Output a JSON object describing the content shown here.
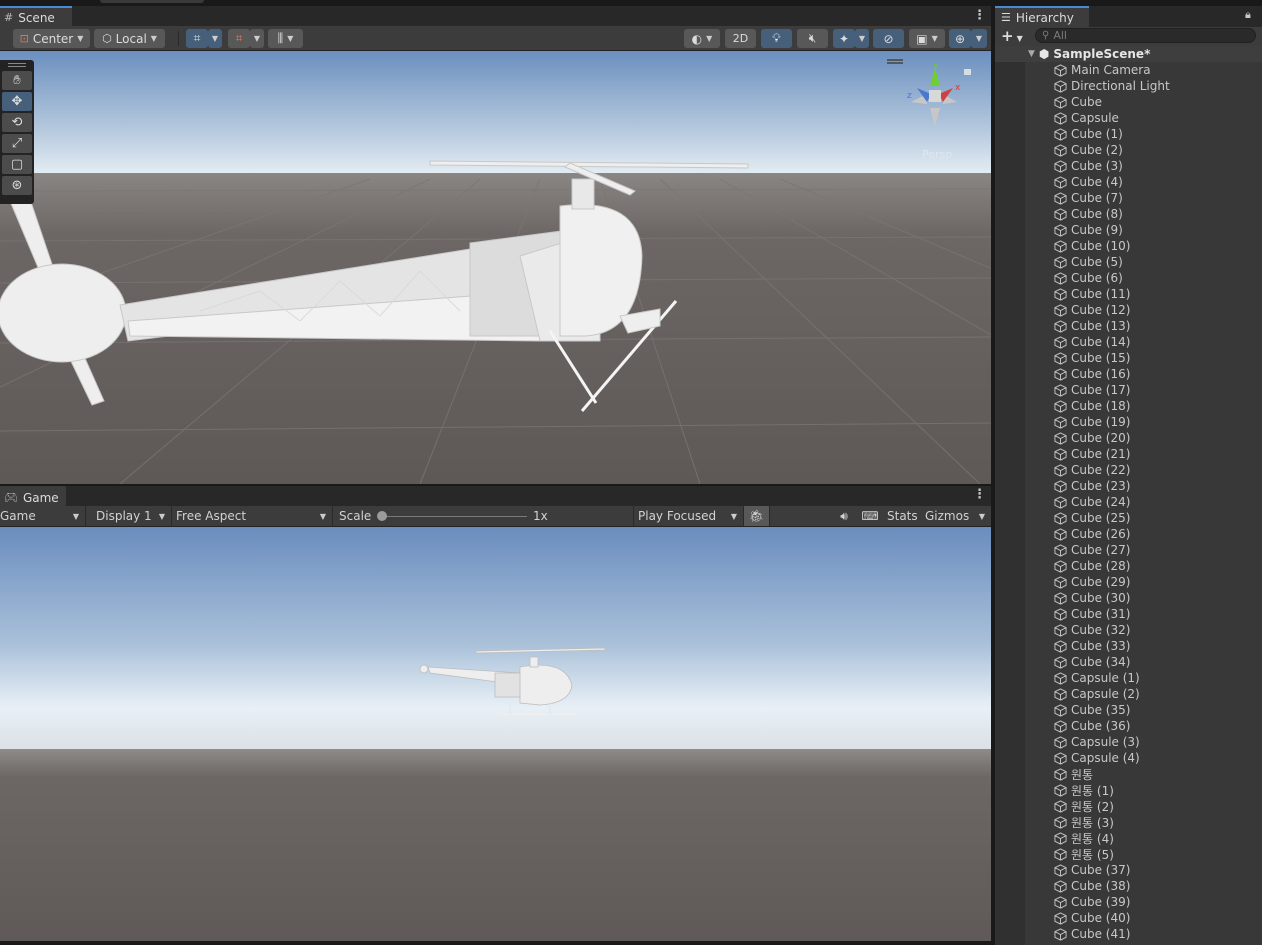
{
  "scene_panel": {
    "tab_title": "Scene",
    "toolbar": {
      "pivot": "Center",
      "space": "Local",
      "mode_2d": "2D"
    },
    "gizmo": {
      "axis_y": "y",
      "axis_x": "x",
      "axis_z": "z",
      "projection": "Persp"
    }
  },
  "game_panel": {
    "tab_title": "Game",
    "view_mode": "Game",
    "display": "Display 1",
    "aspect": "Free Aspect",
    "scale_label": "Scale",
    "scale_value": "1x",
    "play_mode": "Play Focused",
    "stats": "Stats",
    "gizmos": "Gizmos"
  },
  "hierarchy": {
    "tab_title": "Hierarchy",
    "search_placeholder": "All",
    "scene_name": "SampleScene*",
    "items": [
      "Main Camera",
      "Directional Light",
      "Cube",
      "Capsule",
      "Cube (1)",
      "Cube (2)",
      "Cube (3)",
      "Cube (4)",
      "Cube (7)",
      "Cube (8)",
      "Cube (9)",
      "Cube (10)",
      "Cube (5)",
      "Cube (6)",
      "Cube (11)",
      "Cube (12)",
      "Cube (13)",
      "Cube (14)",
      "Cube (15)",
      "Cube (16)",
      "Cube (17)",
      "Cube (18)",
      "Cube (19)",
      "Cube (20)",
      "Cube (21)",
      "Cube (22)",
      "Cube (23)",
      "Cube (24)",
      "Cube (25)",
      "Cube (26)",
      "Cube (27)",
      "Cube (28)",
      "Cube (29)",
      "Cube (30)",
      "Cube (31)",
      "Cube (32)",
      "Cube (33)",
      "Cube (34)",
      "Capsule (1)",
      "Capsule (2)",
      "Cube (35)",
      "Cube (36)",
      "Capsule (3)",
      "Capsule (4)",
      "원통",
      "원통 (1)",
      "원통 (2)",
      "원통 (3)",
      "원통 (4)",
      "원통 (5)",
      "Cube (37)",
      "Cube (38)",
      "Cube (39)",
      "Cube (40)",
      "Cube (41)"
    ]
  },
  "colors": {
    "accent": "#4a8ad0",
    "panel_bg": "#383838",
    "toolbar_bg": "#3c3c3c",
    "selected_button": "#46607c",
    "sky_top": "#6b8fbf",
    "ground": "#5f5957"
  }
}
